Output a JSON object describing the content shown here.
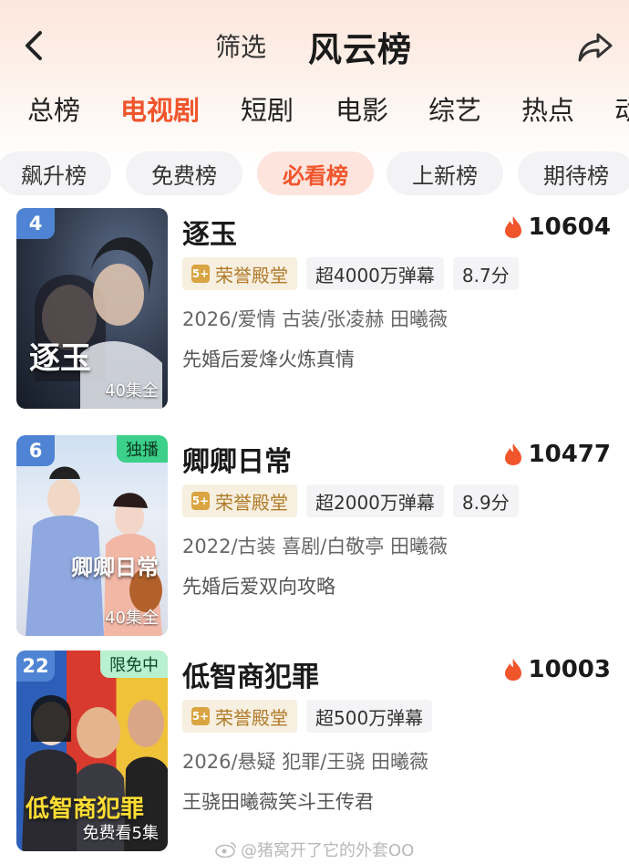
{
  "header": {
    "filter_label": "筛选",
    "title": "风云榜",
    "back_icon": "chevron-left-icon",
    "share_icon": "share-icon"
  },
  "category_tabs": [
    "总榜",
    "电视剧",
    "短剧",
    "电影",
    "综艺",
    "热点",
    "动"
  ],
  "active_category": "电视剧",
  "sub_tabs": [
    "飙升榜",
    "免费榜",
    "必看榜",
    "上新榜",
    "期待榜"
  ],
  "active_sub": "必看榜",
  "colors": {
    "accent": "#f0552c",
    "rank_badge": "#4f84d4",
    "flag": "#3cd08a",
    "honor": "#b07a2a"
  },
  "items": [
    {
      "rank": "4",
      "name": "逐玉",
      "heat": "10604",
      "honor": "荣誉殿堂",
      "danmaku": "超4000万弹幕",
      "score": "8.7分",
      "meta": "2026/爱情 古装/张凌赫 田曦薇",
      "desc": "先婚后爱烽火炼真情",
      "poster_eps": "40集全",
      "poster_title": "逐玉",
      "flag": ""
    },
    {
      "rank": "6",
      "name": "卿卿日常",
      "heat": "10477",
      "honor": "荣誉殿堂",
      "danmaku": "超2000万弹幕",
      "score": "8.9分",
      "meta": "2022/古装 喜剧/白敬亭 田曦薇",
      "desc": "先婚后爱双向攻略",
      "poster_eps": "40集全",
      "poster_title": "卿卿日常",
      "flag": "独播"
    },
    {
      "rank": "22",
      "name": "低智商犯罪",
      "heat": "10003",
      "honor": "荣誉殿堂",
      "danmaku": "超500万弹幕",
      "score": "",
      "meta": "2026/悬疑 犯罪/王骁 田曦薇",
      "desc": "王骁田曦薇笑斗王传君",
      "poster_eps": "免费看5集",
      "poster_title": "低智商犯罪",
      "flag": "限免中"
    }
  ],
  "watermark": "@猪窝开了它的外套OO"
}
